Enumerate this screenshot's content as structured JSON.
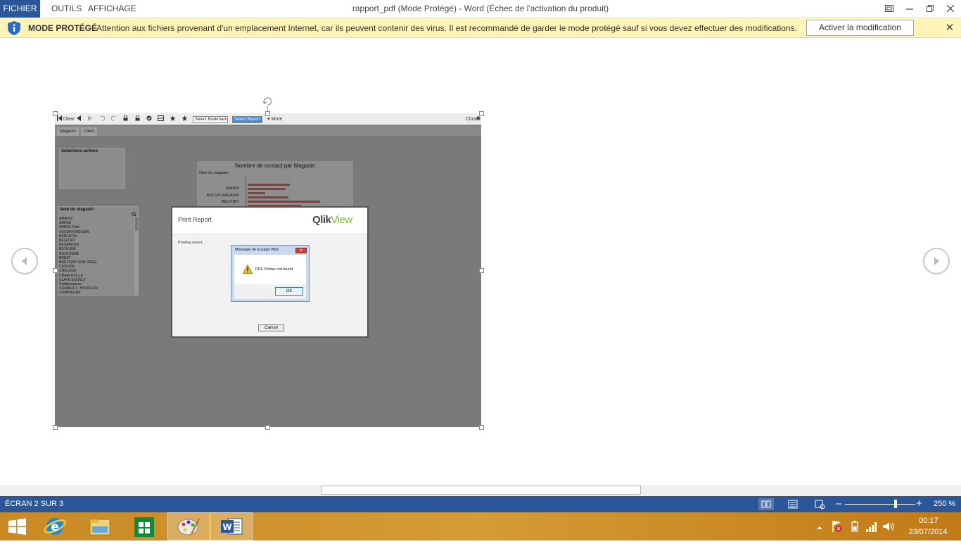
{
  "ribbon": {
    "tabs": [
      "FICHIER",
      "OUTILS",
      "AFFICHAGE"
    ],
    "window_title": "rapport_pdf (Mode Protégé) - Word (Échec de l'activation du produit)"
  },
  "protected_bar": {
    "title": "MODE PROTÉGÉ",
    "message": "Attention aux fichiers provenant d'un emplacement Internet, car ils peuvent contenir des virus. Il est recommandé de garder le mode protégé sauf si vous devez effectuer des modifications.",
    "button": "Activer la modification",
    "close": "✕"
  },
  "qlikview": {
    "toolbar": {
      "clear": "Clear",
      "bookmark_select": "Select Bookmark",
      "report_select": "Select Report",
      "more": "More",
      "close": "Close"
    },
    "tabs": [
      "Magasin",
      "Client"
    ],
    "selections_title": "Sélections actives",
    "store_list_title": "Nom du magasin",
    "stores": [
      "AMIENS",
      "ARRAS",
      "ARRAS Park",
      "AUCUN MAGASIN",
      "BARENTIN",
      "BELFORT",
      "BESANCON",
      "BETHUNE",
      "BOULOGNE",
      "BREST",
      "BRETIGNY SUR ORGE",
      "CESSON",
      "CHALONS",
      "CHARLEVILLE",
      "CLAYE SOUILLY",
      "Collaborateurs",
      "COLMAR 2 - HOUSSEN",
      "COMPIEGNE"
    ],
    "chart": {
      "title": "Nombre de contact par Magasin",
      "subtitle": "Nom du magasin",
      "categories": [
        "ARRAS",
        "AUCUN MAGASIN",
        "BELFORT"
      ]
    },
    "print_dialog": {
      "title": "Print Report",
      "logo_prefix": "Qlik",
      "logo_suffix": "View",
      "status": "Printing report...",
      "cancel": "Cancel"
    },
    "message_box": {
      "title": "Message de la page Web",
      "text": "PDF Printer not found",
      "ok": "OK",
      "close": "x"
    }
  },
  "status_bar": {
    "screen": "ÉCRAN 2 SUR 3",
    "zoom_minus": "–",
    "zoom_plus": "+",
    "zoom_level": "250 %",
    "zoom_fraction": 0.72
  },
  "taskbar": {
    "time": "00:17",
    "date": "23/07/2014"
  },
  "colors": {
    "word_blue": "#2b579a",
    "protected_yellow": "#fff4b8",
    "chart_bar": "#8a3c3c",
    "qlik_green": "#7cb82f"
  }
}
